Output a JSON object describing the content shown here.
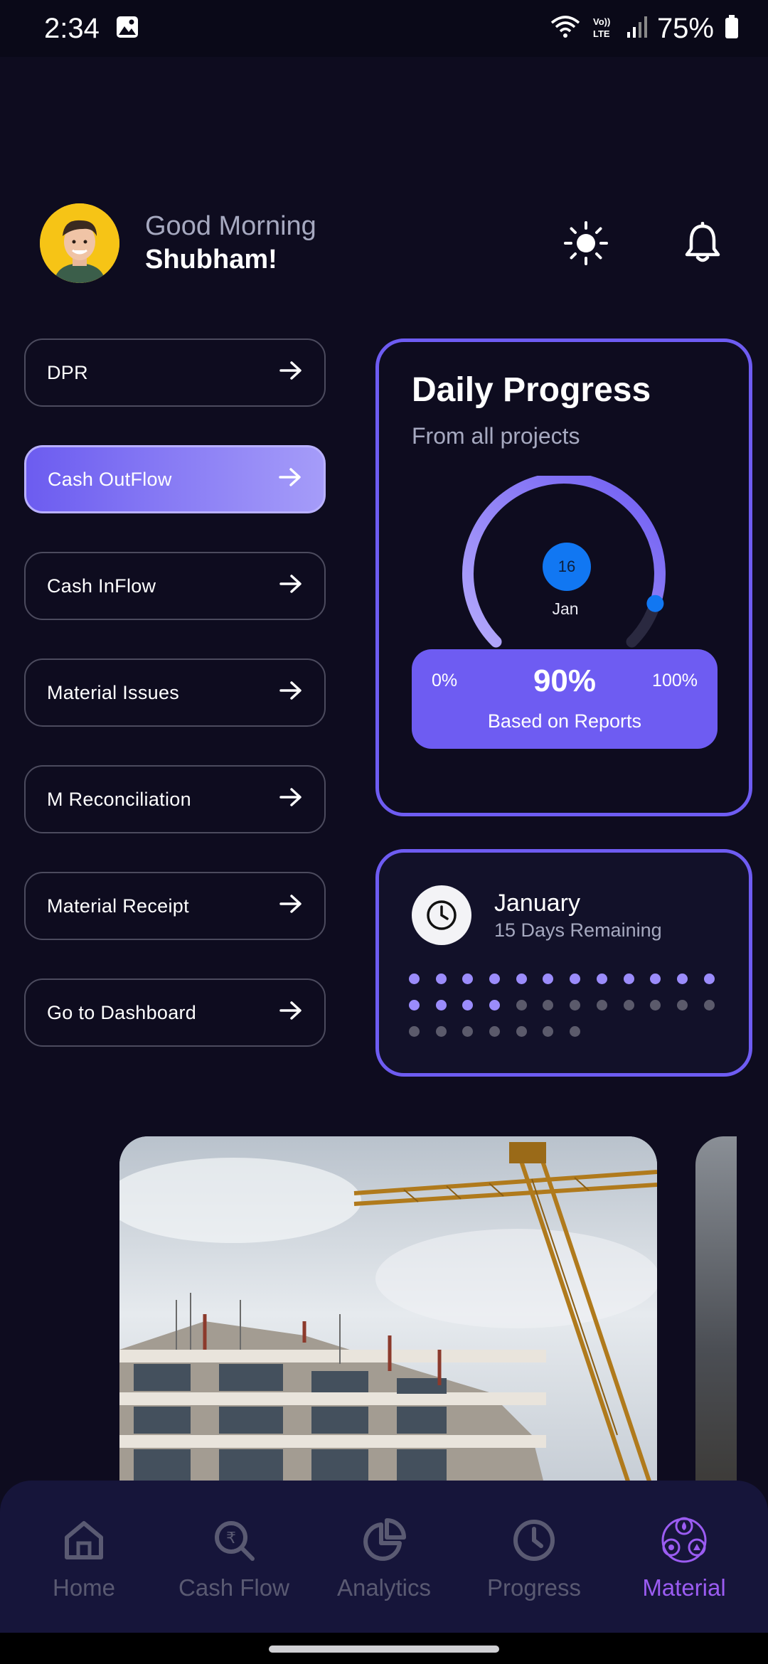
{
  "status_bar": {
    "time": "2:34",
    "battery": "75%",
    "network": "Vo) LTE"
  },
  "header": {
    "greeting": "Good Morning",
    "user_name": "Shubham!",
    "icons": [
      "sun-icon",
      "bell-icon"
    ]
  },
  "menu": {
    "items": [
      {
        "label": "DPR",
        "active": false
      },
      {
        "label": "Cash OutFlow",
        "active": true
      },
      {
        "label": "Cash InFlow",
        "active": false
      },
      {
        "label": "Material Issues",
        "active": false
      },
      {
        "label": "M Reconciliation",
        "active": false
      },
      {
        "label": "Material Receipt",
        "active": false
      },
      {
        "label": "Go to Dashboard",
        "active": false
      }
    ]
  },
  "daily_progress": {
    "title": "Daily Progress",
    "subtitle": "From all projects",
    "day": "16",
    "month": "Jan",
    "min_label": "0%",
    "max_label": "100%",
    "percent_label": "90%",
    "percent_value": 90,
    "caption": "Based on Reports"
  },
  "month_card": {
    "month": "January",
    "remaining": "15 Days Remaining",
    "total_days": 31,
    "elapsed_days": 16
  },
  "bottom_nav": {
    "items": [
      {
        "label": "Home",
        "icon": "home-icon",
        "active": false
      },
      {
        "label": "Cash Flow",
        "icon": "rupee-search-icon",
        "active": false
      },
      {
        "label": "Analytics",
        "icon": "pie-chart-icon",
        "active": false
      },
      {
        "label": "Progress",
        "icon": "clock-icon",
        "active": false
      },
      {
        "label": "Material",
        "icon": "material-icon",
        "active": true
      }
    ]
  },
  "colors": {
    "background": "#0e0c1f",
    "accent": "#6e5cf2",
    "active_nav": "#9b5cf2",
    "gauge_dot": "#1177f2"
  }
}
